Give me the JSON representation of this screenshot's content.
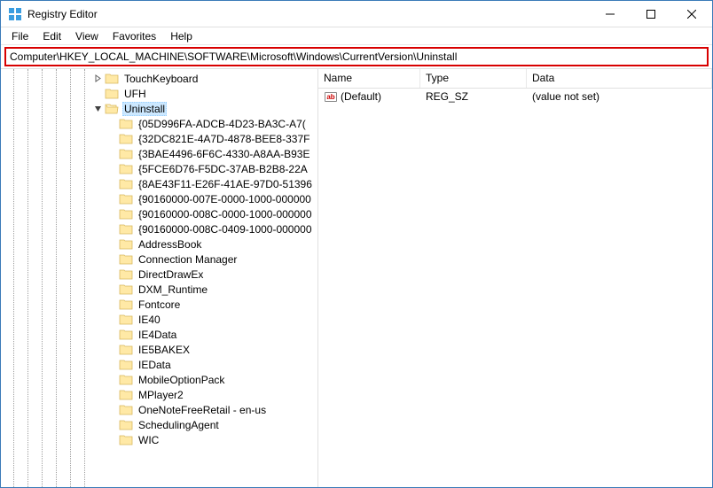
{
  "window": {
    "title": "Registry Editor"
  },
  "menu": {
    "file": "File",
    "edit": "Edit",
    "view": "View",
    "favorites": "Favorites",
    "help": "Help"
  },
  "address": {
    "path": "Computer\\HKEY_LOCAL_MACHINE\\SOFTWARE\\Microsoft\\Windows\\CurrentVersion\\Uninstall"
  },
  "tree": {
    "siblings": [
      {
        "label": "TouchKeyboard",
        "expander": "right"
      },
      {
        "label": "UFH",
        "expander": "none"
      }
    ],
    "selected": {
      "label": "Uninstall",
      "expander": "down"
    },
    "children": [
      {
        "label": "{05D996FA-ADCB-4D23-BA3C-A7("
      },
      {
        "label": "{32DC821E-4A7D-4878-BEE8-337F"
      },
      {
        "label": "{3BAE4496-6F6C-4330-A8AA-B93E"
      },
      {
        "label": "{5FCE6D76-F5DC-37AB-B2B8-22A"
      },
      {
        "label": "{8AE43F11-E26F-41AE-97D0-51396"
      },
      {
        "label": "{90160000-007E-0000-1000-000000"
      },
      {
        "label": "{90160000-008C-0000-1000-000000"
      },
      {
        "label": "{90160000-008C-0409-1000-000000"
      },
      {
        "label": "AddressBook"
      },
      {
        "label": "Connection Manager"
      },
      {
        "label": "DirectDrawEx"
      },
      {
        "label": "DXM_Runtime"
      },
      {
        "label": "Fontcore"
      },
      {
        "label": "IE40"
      },
      {
        "label": "IE4Data"
      },
      {
        "label": "IE5BAKEX"
      },
      {
        "label": "IEData"
      },
      {
        "label": "MobileOptionPack"
      },
      {
        "label": "MPlayer2"
      },
      {
        "label": "OneNoteFreeRetail - en-us"
      },
      {
        "label": "SchedulingAgent"
      },
      {
        "label": "WIC"
      }
    ]
  },
  "values": {
    "columns": {
      "name": "Name",
      "type": "Type",
      "data": "Data"
    },
    "rows": [
      {
        "name": "(Default)",
        "type": "REG_SZ",
        "data": "(value not set)",
        "icon": "ab"
      }
    ]
  }
}
